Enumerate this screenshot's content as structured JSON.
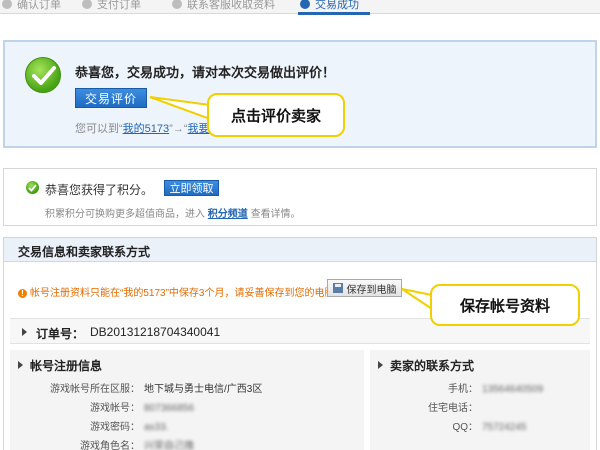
{
  "steps": [
    {
      "label": "确认订单",
      "active": false
    },
    {
      "label": "支付订单",
      "active": false
    },
    {
      "label": "联系客服收取资料",
      "active": false
    },
    {
      "label": "交易成功",
      "active": true
    }
  ],
  "success": {
    "title": "恭喜您，交易成功，请对本次交易做出评价！",
    "review_button": "交易评价",
    "hint_prefix": "您可以到“",
    "hint_link1": "我的5173",
    "hint_mid": "”→“",
    "hint_link2": "我要"
  },
  "callouts": {
    "review": "点击评价卖家",
    "save": "保存帐号资料"
  },
  "points": {
    "title": "恭喜您获得了积分。",
    "claim_button": "立即领取",
    "desc_prefix": "积累积分可换购更多超值商品，进入",
    "desc_link": "积分频道",
    "desc_suffix": "查看详情。"
  },
  "info": {
    "header": "交易信息和卖家联系方式",
    "warning": "帐号注册资料只能在“我的5173”中保存3个月，请妥善保存到您的电脑",
    "save_button": "保存到电脑",
    "order_label": "订单号：",
    "order_value": "DB20131218704340041",
    "account_title": "帐号注册信息",
    "account_rows": [
      {
        "label": "游戏帐号所在区服：",
        "value": "地下城与勇士电信/广西3区"
      },
      {
        "label": "游戏帐号：",
        "value": "807366856"
      },
      {
        "label": "游戏密码：",
        "value": "as33."
      },
      {
        "label": "游戏角色名：",
        "value": "兴荣自己撸"
      }
    ],
    "seller_title": "卖家的联系方式",
    "seller_rows": [
      {
        "label": "手机：",
        "value": "13564640509"
      },
      {
        "label": "住宅电话：",
        "value": ""
      },
      {
        "label": "QQ：",
        "value": "75724245"
      }
    ]
  },
  "colors": {
    "accent": "#2466b4",
    "callout_border": "#f0d000",
    "warning": "#e06a00",
    "success_green": "#46a312"
  }
}
